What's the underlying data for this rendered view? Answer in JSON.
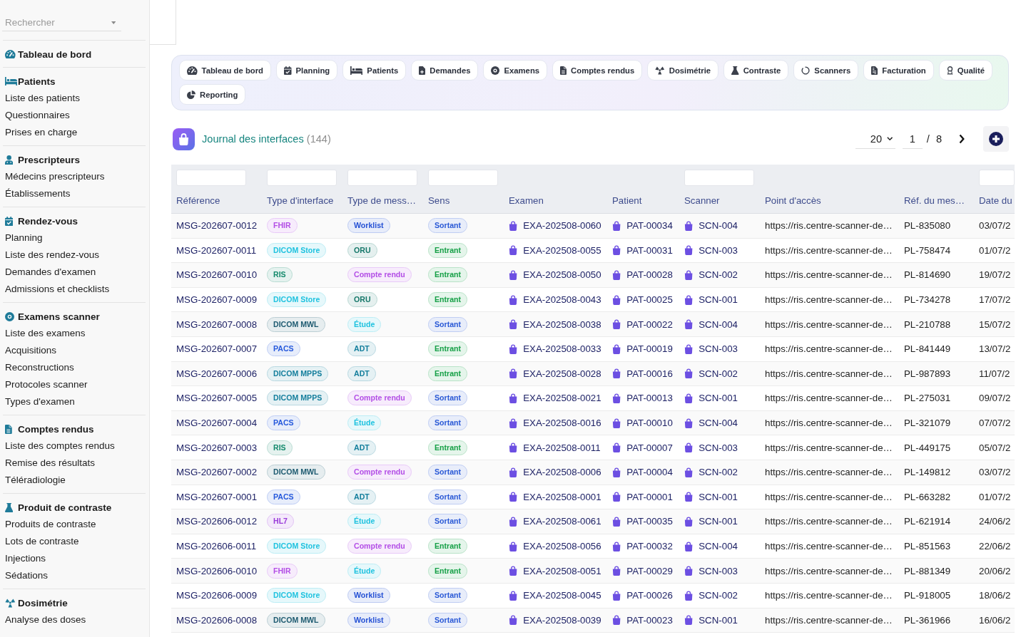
{
  "sidebar": {
    "search": {
      "placeholder": "Rechercher"
    },
    "sections": [
      {
        "title": "Tableau de bord"
      },
      {
        "title": "Patients",
        "items": [
          "Liste des patients",
          "Questionnaires",
          "Prises en charge"
        ]
      },
      {
        "title": "Prescripteurs",
        "items": [
          "Médecins prescripteurs",
          "Établissements"
        ]
      },
      {
        "title": "Rendez-vous",
        "items": [
          "Planning",
          "Liste des rendez-vous",
          "Demandes d'examen",
          "Admissions et checklists"
        ]
      },
      {
        "title": "Examens scanner",
        "items": [
          "Liste des examens",
          "Acquisitions",
          "Reconstructions",
          "Protocoles scanner",
          "Types d'examen"
        ]
      },
      {
        "title": "Comptes rendus",
        "items": [
          "Liste des comptes rendus",
          "Remise des résultats",
          "Téléradiologie"
        ]
      },
      {
        "title": "Produit de contraste",
        "items": [
          "Produits de contraste",
          "Lots de contraste",
          "Injections",
          "Sédations"
        ]
      },
      {
        "title": "Dosimétrie",
        "items": [
          "Analyse des doses"
        ]
      }
    ]
  },
  "module_tabs": [
    "Tableau de bord",
    "Planning",
    "Patients",
    "Demandes",
    "Examens",
    "Comptes rendus",
    "Dosimétrie",
    "Contraste",
    "Scanners",
    "Facturation",
    "Qualité",
    "Reporting"
  ],
  "journal": {
    "title": "Journal des interfaces",
    "count": "(144)",
    "page_size": "20",
    "page": "1",
    "separator": "/",
    "page_total": "8"
  },
  "table": {
    "columns": [
      {
        "label": "Référence",
        "filter": true
      },
      {
        "label": "Type d'interface",
        "filter": true
      },
      {
        "label": "Type de mess…",
        "filter": true
      },
      {
        "label": "Sens",
        "filter": true
      },
      {
        "label": "Examen",
        "filter": false
      },
      {
        "label": "Patient",
        "filter": false
      },
      {
        "label": "Scanner",
        "filter": true
      },
      {
        "label": "Point d'accès",
        "filter": false
      },
      {
        "label": "Réf. du mes…",
        "filter": false
      },
      {
        "label": "Date du",
        "filter": true
      }
    ],
    "rows": [
      {
        "reference": "MSG-202607-0012",
        "interface": {
          "label": "FHIR",
          "color": "#b34ee6"
        },
        "message": {
          "label": "Worklist",
          "color": "#2450d4"
        },
        "direction": {
          "label": "Sortant",
          "color": "#2a59d6"
        },
        "exam": "EXA-202508-0060",
        "patient": "PAT-00034",
        "scanner": "SCN-004",
        "endpoint": "https://ris.centre-scanner-de…",
        "message_ref": "PL-835080",
        "date": "03/07/2"
      },
      {
        "reference": "MSG-202607-0011",
        "interface": {
          "label": "DICOM Store",
          "color": "#1fc2df"
        },
        "message": {
          "label": "ORU",
          "color": "#16786a"
        },
        "direction": {
          "label": "Entrant",
          "color": "#16a047"
        },
        "exam": "EXA-202508-0055",
        "patient": "PAT-00031",
        "scanner": "SCN-003",
        "endpoint": "https://ris.centre-scanner-de…",
        "message_ref": "PL-758474",
        "date": "01/07/2"
      },
      {
        "reference": "MSG-202607-0010",
        "interface": {
          "label": "RIS",
          "color": "#148a6c"
        },
        "message": {
          "label": "Compte rendu",
          "color": "#b34ee6"
        },
        "direction": {
          "label": "Entrant",
          "color": "#16a047"
        },
        "exam": "EXA-202508-0050",
        "patient": "PAT-00028",
        "scanner": "SCN-002",
        "endpoint": "https://ris.centre-scanner-de…",
        "message_ref": "PL-814690",
        "date": "19/07/2"
      },
      {
        "reference": "MSG-202607-0009",
        "interface": {
          "label": "DICOM Store",
          "color": "#1fc2df"
        },
        "message": {
          "label": "ORU",
          "color": "#16786a"
        },
        "direction": {
          "label": "Entrant",
          "color": "#16a047"
        },
        "exam": "EXA-202508-0043",
        "patient": "PAT-00025",
        "scanner": "SCN-001",
        "endpoint": "https://ris.centre-scanner-de…",
        "message_ref": "PL-734278",
        "date": "17/07/2"
      },
      {
        "reference": "MSG-202607-0008",
        "interface": {
          "label": "DICOM MWL",
          "color": "#1d5a70"
        },
        "message": {
          "label": "Étude",
          "color": "#1fc2df"
        },
        "direction": {
          "label": "Sortant",
          "color": "#2a59d6"
        },
        "exam": "EXA-202508-0038",
        "patient": "PAT-00022",
        "scanner": "SCN-004",
        "endpoint": "https://ris.centre-scanner-de…",
        "message_ref": "PL-210788",
        "date": "15/07/2"
      },
      {
        "reference": "MSG-202607-0007",
        "interface": {
          "label": "PACS",
          "color": "#2659dc"
        },
        "message": {
          "label": "ADT",
          "color": "#137e9c"
        },
        "direction": {
          "label": "Entrant",
          "color": "#16a047"
        },
        "exam": "EXA-202508-0033",
        "patient": "PAT-00019",
        "scanner": "SCN-003",
        "endpoint": "https://ris.centre-scanner-de…",
        "message_ref": "PL-841449",
        "date": "13/07/2"
      },
      {
        "reference": "MSG-202607-0006",
        "interface": {
          "label": "DICOM MPPS",
          "color": "#137e9c"
        },
        "message": {
          "label": "ADT",
          "color": "#137e9c"
        },
        "direction": {
          "label": "Entrant",
          "color": "#16a047"
        },
        "exam": "EXA-202508-0028",
        "patient": "PAT-00016",
        "scanner": "SCN-002",
        "endpoint": "https://ris.centre-scanner-de…",
        "message_ref": "PL-987893",
        "date": "11/07/2"
      },
      {
        "reference": "MSG-202607-0005",
        "interface": {
          "label": "DICOM MPPS",
          "color": "#137e9c"
        },
        "message": {
          "label": "Compte rendu",
          "color": "#b34ee6"
        },
        "direction": {
          "label": "Sortant",
          "color": "#2a59d6"
        },
        "exam": "EXA-202508-0021",
        "patient": "PAT-00013",
        "scanner": "SCN-001",
        "endpoint": "https://ris.centre-scanner-de…",
        "message_ref": "PL-275031",
        "date": "09/07/2"
      },
      {
        "reference": "MSG-202607-0004",
        "interface": {
          "label": "PACS",
          "color": "#2659dc"
        },
        "message": {
          "label": "Étude",
          "color": "#1fc2df"
        },
        "direction": {
          "label": "Sortant",
          "color": "#2a59d6"
        },
        "exam": "EXA-202508-0016",
        "patient": "PAT-00010",
        "scanner": "SCN-004",
        "endpoint": "https://ris.centre-scanner-de…",
        "message_ref": "PL-321079",
        "date": "07/07/2"
      },
      {
        "reference": "MSG-202607-0003",
        "interface": {
          "label": "RIS",
          "color": "#148a6c"
        },
        "message": {
          "label": "ADT",
          "color": "#137e9c"
        },
        "direction": {
          "label": "Entrant",
          "color": "#16a047"
        },
        "exam": "EXA-202508-0011",
        "patient": "PAT-00007",
        "scanner": "SCN-003",
        "endpoint": "https://ris.centre-scanner-de…",
        "message_ref": "PL-449175",
        "date": "05/07/2"
      },
      {
        "reference": "MSG-202607-0002",
        "interface": {
          "label": "DICOM MWL",
          "color": "#1d5a70"
        },
        "message": {
          "label": "Compte rendu",
          "color": "#b34ee6"
        },
        "direction": {
          "label": "Sortant",
          "color": "#2a59d6"
        },
        "exam": "EXA-202508-0006",
        "patient": "PAT-00004",
        "scanner": "SCN-002",
        "endpoint": "https://ris.centre-scanner-de…",
        "message_ref": "PL-149812",
        "date": "03/07/2"
      },
      {
        "reference": "MSG-202607-0001",
        "interface": {
          "label": "PACS",
          "color": "#2659dc"
        },
        "message": {
          "label": "ADT",
          "color": "#137e9c"
        },
        "direction": {
          "label": "Sortant",
          "color": "#2a59d6"
        },
        "exam": "EXA-202508-0001",
        "patient": "PAT-00001",
        "scanner": "SCN-001",
        "endpoint": "https://ris.centre-scanner-de…",
        "message_ref": "PL-663282",
        "date": "01/07/2"
      },
      {
        "reference": "MSG-202606-0012",
        "interface": {
          "label": "HL7",
          "color": "#9a3bd9"
        },
        "message": {
          "label": "Étude",
          "color": "#1fc2df"
        },
        "direction": {
          "label": "Sortant",
          "color": "#2a59d6"
        },
        "exam": "EXA-202508-0061",
        "patient": "PAT-00035",
        "scanner": "SCN-001",
        "endpoint": "https://ris.centre-scanner-de…",
        "message_ref": "PL-621914",
        "date": "24/06/2"
      },
      {
        "reference": "MSG-202606-0011",
        "interface": {
          "label": "DICOM Store",
          "color": "#1fc2df"
        },
        "message": {
          "label": "Compte rendu",
          "color": "#b34ee6"
        },
        "direction": {
          "label": "Entrant",
          "color": "#16a047"
        },
        "exam": "EXA-202508-0056",
        "patient": "PAT-00032",
        "scanner": "SCN-004",
        "endpoint": "https://ris.centre-scanner-de…",
        "message_ref": "PL-851563",
        "date": "22/06/2"
      },
      {
        "reference": "MSG-202606-0010",
        "interface": {
          "label": "FHIR",
          "color": "#b34ee6"
        },
        "message": {
          "label": "Étude",
          "color": "#1fc2df"
        },
        "direction": {
          "label": "Entrant",
          "color": "#16a047"
        },
        "exam": "EXA-202508-0051",
        "patient": "PAT-00029",
        "scanner": "SCN-003",
        "endpoint": "https://ris.centre-scanner-de…",
        "message_ref": "PL-881349",
        "date": "20/06/2"
      },
      {
        "reference": "MSG-202606-0009",
        "interface": {
          "label": "DICOM Store",
          "color": "#1fc2df"
        },
        "message": {
          "label": "Worklist",
          "color": "#2450d4"
        },
        "direction": {
          "label": "Sortant",
          "color": "#2a59d6"
        },
        "exam": "EXA-202508-0045",
        "patient": "PAT-00026",
        "scanner": "SCN-002",
        "endpoint": "https://ris.centre-scanner-de…",
        "message_ref": "PL-918005",
        "date": "18/06/2"
      },
      {
        "reference": "MSG-202606-0008",
        "interface": {
          "label": "DICOM MWL",
          "color": "#1d5a70"
        },
        "message": {
          "label": "Worklist",
          "color": "#2450d4"
        },
        "direction": {
          "label": "Sortant",
          "color": "#2a59d6"
        },
        "exam": "EXA-202508-0039",
        "patient": "PAT-00023",
        "scanner": "SCN-001",
        "endpoint": "https://ris.centre-scanner-de…",
        "message_ref": "PL-361966",
        "date": "16/06/2"
      }
    ]
  }
}
